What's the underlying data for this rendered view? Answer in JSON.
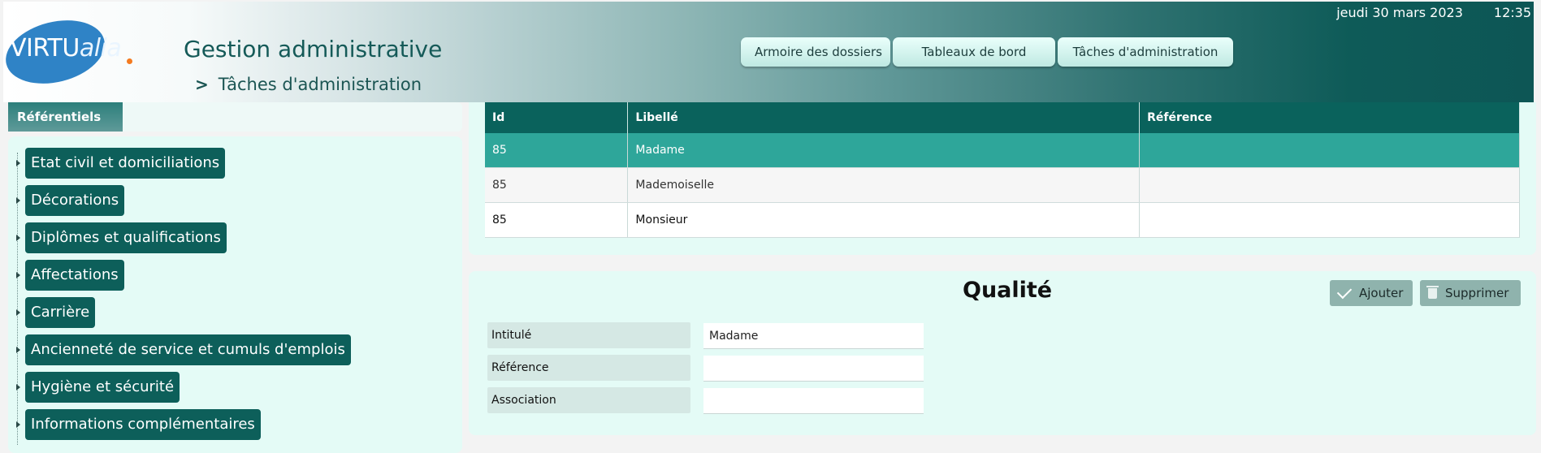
{
  "header": {
    "logo_prefix": "VIRTU",
    "logo_suffix": "alia",
    "app_title": "Gestion administrative",
    "breadcrumb": "Tâches d'administration",
    "date": "jeudi 30 mars 2023",
    "time": "12:35",
    "nav_tabs": [
      "Armoire des dossiers",
      "Tableaux de bord",
      "Tâches d'administration"
    ]
  },
  "left": {
    "tab_label": "Référentiels",
    "items": [
      "Etat civil et domiciliations",
      "Décorations",
      "Diplômes et qualifications",
      "Affectations",
      "Carrière",
      "Ancienneté de service et cumuls d'emplois",
      "Hygiène et sécurité",
      "Informations complémentaires"
    ]
  },
  "table": {
    "columns": [
      "Id",
      "Libellé",
      "Référence"
    ],
    "rows": [
      {
        "id": "85",
        "libelle": "Madame",
        "reference": ""
      },
      {
        "id": "85",
        "libelle": "Mademoiselle",
        "reference": ""
      },
      {
        "id": "85",
        "libelle": "Monsieur",
        "reference": ""
      }
    ],
    "selected_row": 0
  },
  "form": {
    "title": "Qualité",
    "add_label": "Ajouter",
    "delete_label": "Supprimer",
    "fields": [
      {
        "label": "Intitulé",
        "value": "Madame"
      },
      {
        "label": "Référence",
        "value": ""
      },
      {
        "label": "Association",
        "value": ""
      }
    ]
  },
  "colors": {
    "header_dark": "#0d5655",
    "tree_button": "#0d5f5a",
    "table_header": "#0a625c",
    "selected_row": "#2ea69a",
    "panel_bg": "#e4fbf6",
    "logo_blue": "#2f83c6",
    "logo_dot": "#f47b20"
  }
}
